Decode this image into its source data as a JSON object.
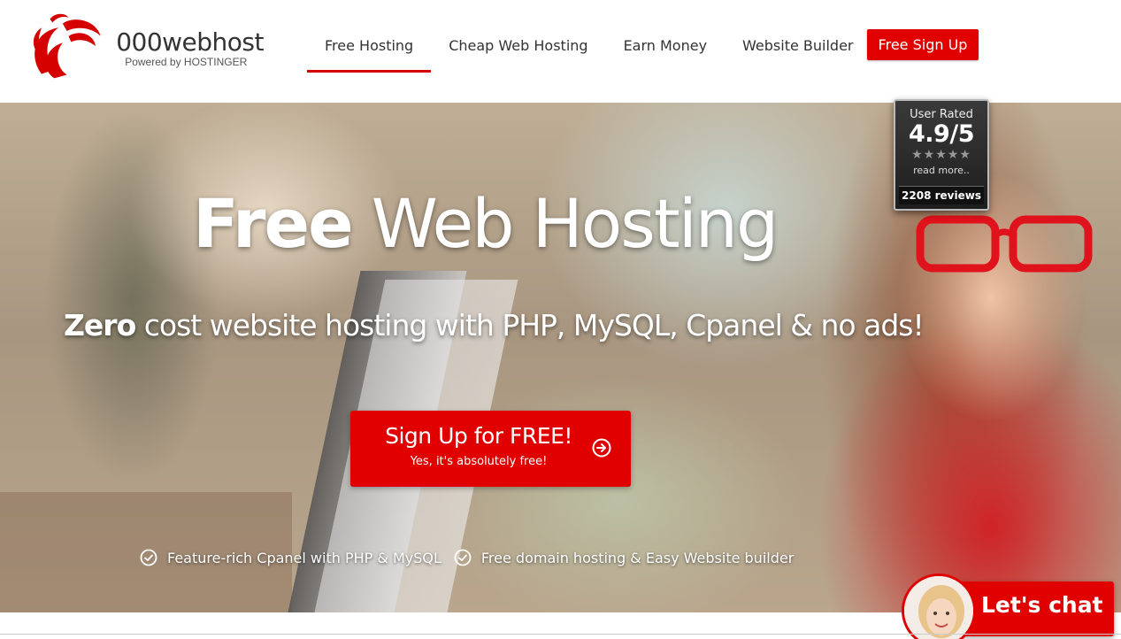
{
  "header": {
    "logo_name": "000webhost",
    "logo_tagline": "Powered by HOSTINGER",
    "nav": [
      {
        "label": "Free Hosting",
        "active": true
      },
      {
        "label": "Cheap Web Hosting",
        "active": false
      },
      {
        "label": "Earn Money",
        "active": false
      },
      {
        "label": "Website Builder",
        "active": false
      }
    ],
    "signup_label": "Free Sign Up"
  },
  "hero": {
    "title_bold": "Free",
    "title_light": "Web Hosting",
    "subtitle_bold": "Zero",
    "subtitle_rest": "cost website hosting with PHP, MySQL, Cpanel & no ads!",
    "cta_main": "Sign Up for FREE!",
    "cta_sub": "Yes, it's absolutely free!",
    "features": [
      "Feature-rich Cpanel with PHP & MySQL",
      "Free domain hosting & Easy Website builder"
    ]
  },
  "rating": {
    "label": "User Rated",
    "score": "4.9/5",
    "stars": "★★★★★",
    "more": "read more..",
    "count": "2208 reviews"
  },
  "chat": {
    "label": "Let's chat"
  },
  "colors": {
    "brand_red": "#e00000",
    "text_dark": "#333333"
  },
  "icons": {
    "logo": "swirl-logo-icon",
    "check": "check-circle-icon",
    "arrow": "arrow-circle-right-icon"
  }
}
